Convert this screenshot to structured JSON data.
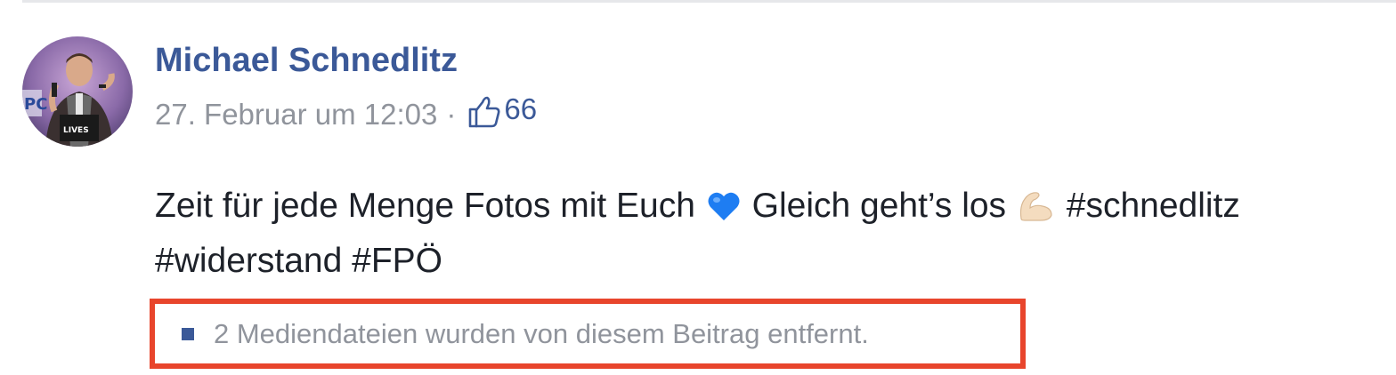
{
  "post": {
    "author": "Michael Schnedlitz",
    "timestamp": "27. Februar um 12:03",
    "separator": "·",
    "like_count": "66",
    "text_part1": "Zeit für jede Menge Fotos mit Euch",
    "text_part2": "Gleich geht’s los",
    "text_part3": "#schnedlitz #widerstand #FPÖ",
    "emojis": [
      "blue-heart",
      "flexed-biceps"
    ],
    "removed_media_notice": "2 Mediendateien wurden von diesem Beitrag entfernt."
  },
  "colors": {
    "author_link": "#3b5998",
    "meta_gray": "#90949c",
    "highlight_border": "#e8452c",
    "text": "#1d2129"
  }
}
